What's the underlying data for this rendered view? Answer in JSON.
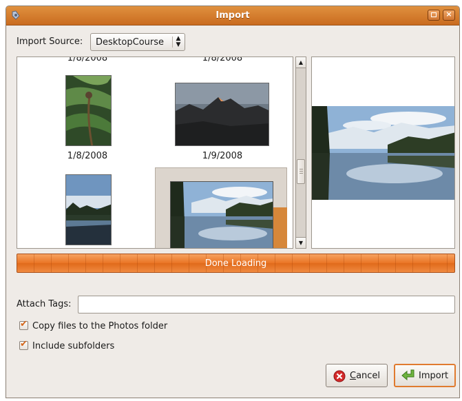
{
  "window": {
    "title": "Import"
  },
  "import_source": {
    "label": "Import Source:",
    "selected": "DesktopCourse"
  },
  "thumbnails": {
    "top_dates": [
      "1/8/2008",
      "1/8/2008"
    ],
    "row1_dates": [
      "1/8/2008",
      "1/9/2008"
    ]
  },
  "progress": {
    "text": "Done Loading",
    "value_percent": 100
  },
  "tags": {
    "label": "Attach Tags:",
    "value": "",
    "placeholder": ""
  },
  "options": {
    "copy_files": {
      "label": "Copy files to the Photos folder",
      "checked": true
    },
    "include_subfolders": {
      "label": "Include subfolders",
      "checked": true
    }
  },
  "buttons": {
    "cancel": {
      "mnemonic": "C",
      "rest": "ancel"
    },
    "import": {
      "label": "Import"
    }
  },
  "colors": {
    "titlebar": "#d27a2d",
    "progress": "#ea7424",
    "check": "#d3661b"
  }
}
